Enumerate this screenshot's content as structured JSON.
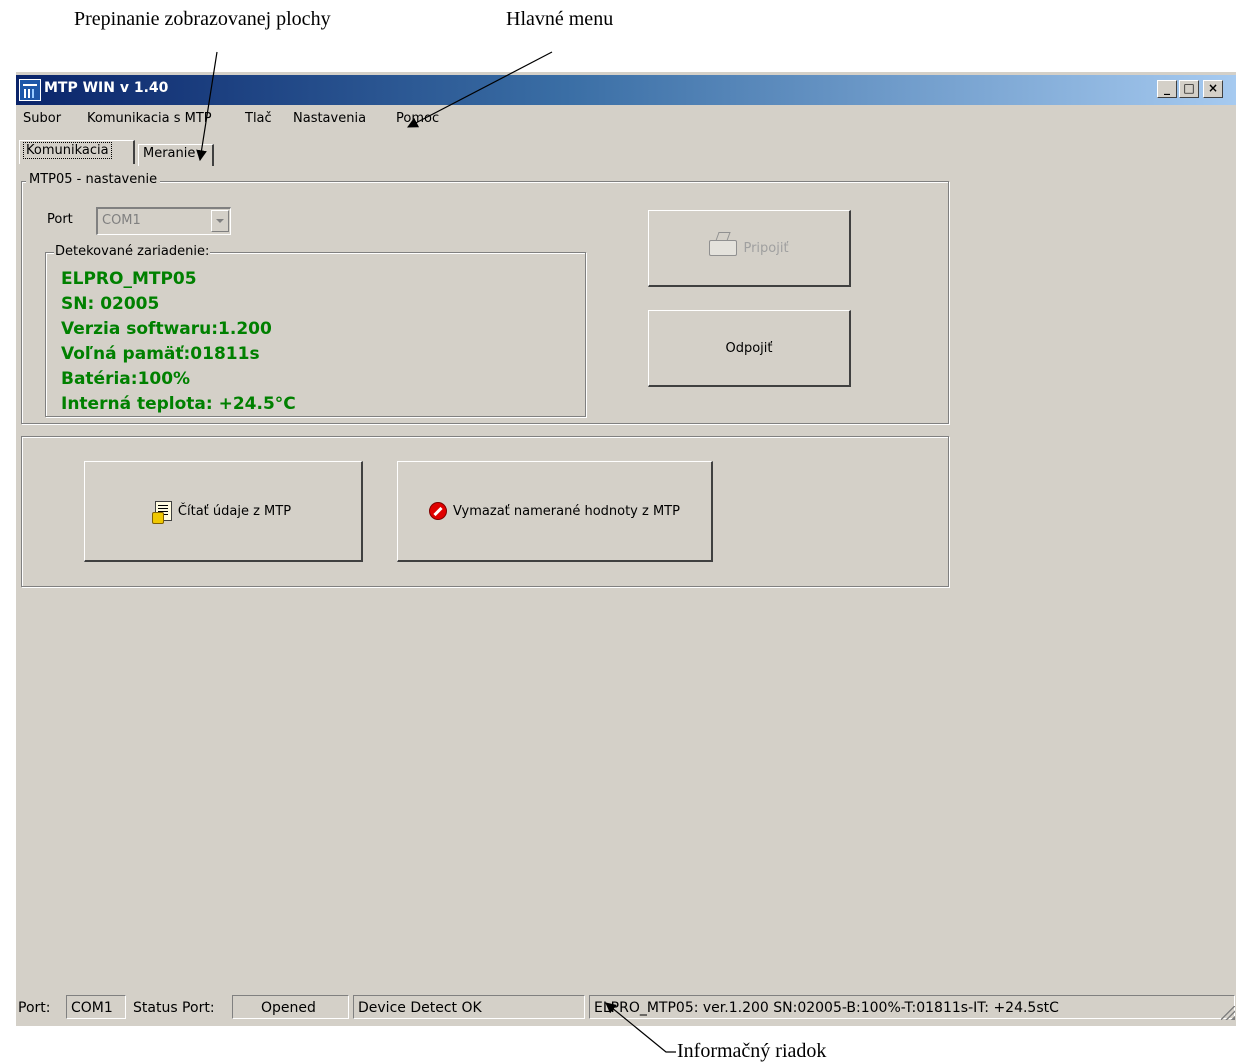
{
  "annotations": {
    "tab_switch": "Prepinanie zobrazovanej plochy",
    "main_menu": "Hlavné menu",
    "info_line": "Informačný riadok"
  },
  "window": {
    "title": "MTP WIN  v 1.40",
    "minimize": "_",
    "maximize": "□",
    "close": "×"
  },
  "menu": [
    "Subor",
    "Komunikacia s MTP",
    "Tlač",
    "Nastavenia",
    "Pomoc"
  ],
  "tabs": [
    {
      "label": "Komunikacia",
      "active": true
    },
    {
      "label": "Meranie",
      "active": false
    }
  ],
  "settings_group": {
    "title": "MTP05 - nastavenie",
    "port_label": "Port",
    "port_value": "COM1",
    "detected": {
      "title": "Detekované zariadenie:",
      "lines": [
        "ELPRO_MTP05",
        "SN: 02005",
        "Verzia softwaru:1.200",
        "Voľná pamäť:01811s",
        "Batéria:100%",
        "Interná teplota: +24.5°C"
      ]
    },
    "connect_button": "Pripojiť",
    "disconnect_button": "Odpojiť"
  },
  "actions": {
    "read_button": "Čítať údaje z MTP",
    "erase_button": "Vymazať namerané hodnoty z MTP"
  },
  "statusbar": {
    "port_label": "Port:",
    "port_value": "COM1",
    "status_label": "Status Port:",
    "status_value": "Opened",
    "detect": "Device Detect OK",
    "info": "ELPRO_MTP05: ver.1.200 SN:02005-B:100%-T:01811s-IT: +24.5stC"
  },
  "colors": {
    "window_bg": "#d4d0c8",
    "title_start": "#0a246a",
    "title_end": "#a6caf0",
    "device_text": "#008000"
  }
}
